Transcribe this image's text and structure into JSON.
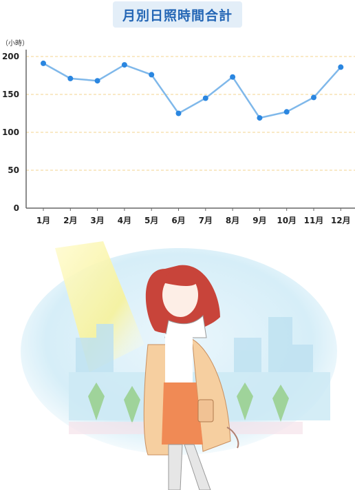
{
  "title": "月別日照時間合計",
  "unit_label": "（小時）",
  "chart_data": {
    "type": "line",
    "title": "月別日照時間合計",
    "ylabel": "（小時）",
    "xlabel": "",
    "categories": [
      "1月",
      "2月",
      "3月",
      "4月",
      "5月",
      "6月",
      "7月",
      "8月",
      "9月",
      "10月",
      "11月",
      "12月"
    ],
    "series": [
      {
        "values": [
          191,
          171,
          168,
          189,
          176,
          125,
          145,
          173,
          119,
          127,
          146,
          186
        ]
      }
    ],
    "ylim": [
      0,
      200
    ],
    "yticks": [
      0,
      50,
      100,
      150,
      200
    ],
    "grid": true,
    "colors": {
      "line": "#7fb8ea",
      "marker": "#2a86e0",
      "grid": "#f3d38e",
      "axis": "#666666"
    }
  },
  "illustration": {
    "description_icon": "woman-walking-in-sunny-city-illustration"
  }
}
